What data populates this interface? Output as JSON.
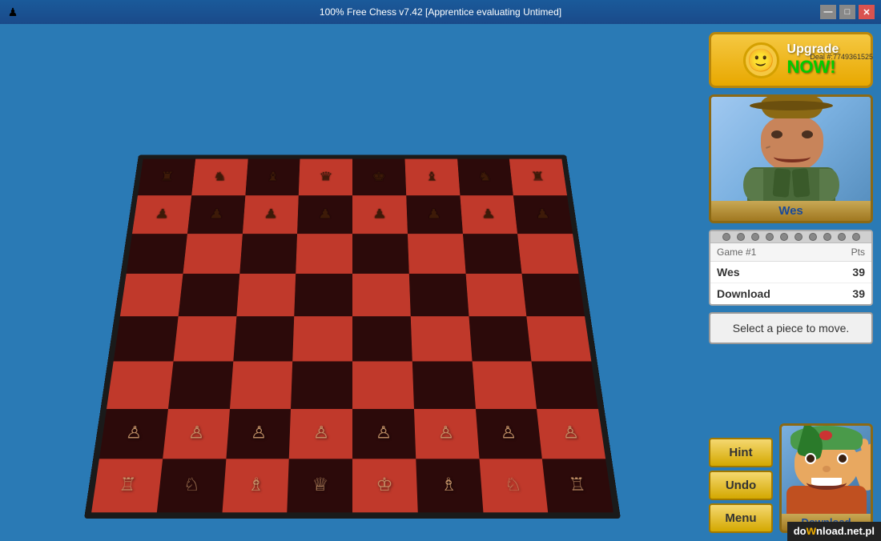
{
  "window": {
    "title": "100% Free Chess v7.42 [Apprentice evaluating Untimed]",
    "icon": "♟"
  },
  "title_buttons": {
    "minimize": "—",
    "maximize": "□",
    "close": "✕"
  },
  "deal": {
    "label": "Deal #:",
    "number": "7749361525"
  },
  "upgrade": {
    "smiley": "🙂",
    "line1": "Upgrade",
    "line2": "NOW!"
  },
  "player_wes": {
    "name": "Wes"
  },
  "score": {
    "game_label": "Game #1",
    "pts_label": "Pts",
    "wes_label": "Wes",
    "wes_score": "39",
    "download_label": "Download",
    "download_score": "39"
  },
  "status": {
    "message": "Select a piece to move."
  },
  "buttons": {
    "hint": "Hint",
    "undo": "Undo",
    "menu": "Menu"
  },
  "download_player": {
    "name": "Download"
  },
  "footer": {
    "text": "do",
    "accent": "w",
    "rest": "nload.net.pl"
  },
  "board": {
    "pieces": [
      [
        "♜",
        "♞",
        "♝",
        "♛",
        "♚",
        "♝",
        "♞",
        "♜"
      ],
      [
        "♟",
        "♟",
        "♟",
        "♟",
        "♟",
        "♟",
        "♟",
        "♟"
      ],
      [
        "",
        "",
        "",
        "",
        "",
        "",
        "",
        ""
      ],
      [
        "",
        "",
        "",
        "",
        "",
        "",
        "",
        ""
      ],
      [
        "",
        "",
        "",
        "",
        "",
        "",
        "",
        ""
      ],
      [
        "",
        "",
        "",
        "",
        "",
        "",
        "",
        ""
      ],
      [
        "♙",
        "♙",
        "♙",
        "♙",
        "♙",
        "♙",
        "♙",
        "♙"
      ],
      [
        "♖",
        "♘",
        "♗",
        "♕",
        "♔",
        "♗",
        "♘",
        "♖"
      ]
    ]
  }
}
